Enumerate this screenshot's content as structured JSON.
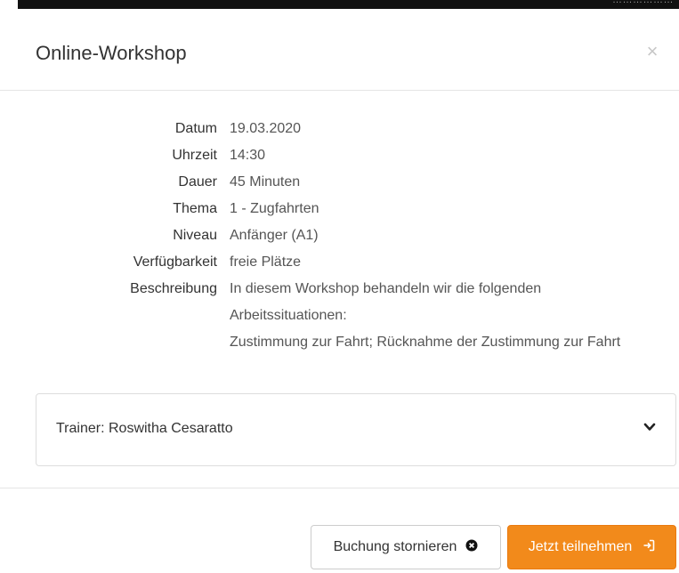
{
  "topbar": {
    "text": "………………"
  },
  "modal": {
    "title": "Online-Workshop",
    "close_symbol": "×"
  },
  "details": [
    {
      "label": "Datum",
      "value": "19.03.2020"
    },
    {
      "label": "Uhrzeit",
      "value": "14:30"
    },
    {
      "label": "Dauer",
      "value": "45 Minuten"
    },
    {
      "label": "Thema",
      "value": "1 - Zugfahrten"
    },
    {
      "label": "Niveau",
      "value": "Anfänger (A1)"
    },
    {
      "label": "Verfügbarkeit",
      "value": "freie Plätze"
    }
  ],
  "description": {
    "label": "Beschreibung",
    "line1": "In diesem Workshop behandeln wir die folgenden",
    "line2": "Arbeitssituationen:",
    "line3": "Zustimmung zur Fahrt; Rücknahme der Zustimmung zur Fahrt"
  },
  "trainer": {
    "label": "Trainer:",
    "name": "Roswitha Cesaratto",
    "icon": "chevron-down-icon"
  },
  "buttons": {
    "cancel_label": "Buchung stornieren",
    "cancel_icon": "times-circle-icon",
    "join_label": "Jetzt teilnehmen",
    "join_icon": "sign-in-icon"
  },
  "colors": {
    "accent": "#f28a1b",
    "text": "#333333",
    "border": "#dddddd"
  }
}
